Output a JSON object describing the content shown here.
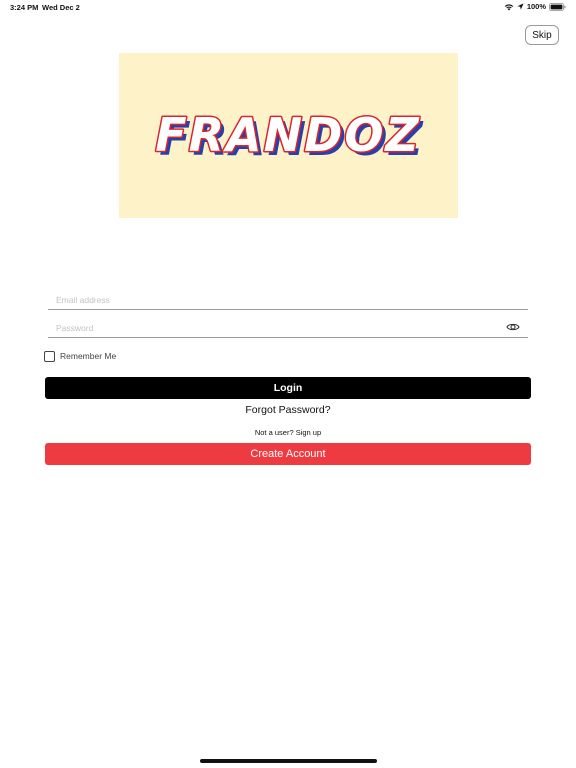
{
  "status_bar": {
    "time": "3:24 PM",
    "date": "Wed Dec 2",
    "battery": "100%"
  },
  "header": {
    "skip_label": "Skip"
  },
  "logo": {
    "text": "FRANDOZ",
    "background": "#fef3c8"
  },
  "form": {
    "email_placeholder": "Email address",
    "email_value": "",
    "password_placeholder": "Password",
    "password_value": "",
    "remember_label": "Remember Me",
    "remember_checked": false
  },
  "actions": {
    "login_label": "Login",
    "forgot_label": "Forgot Password?",
    "signup_prompt": "Not a user? Sign up",
    "create_label": "Create Account"
  },
  "colors": {
    "primary_button": "#000000",
    "create_button": "#ee3b41"
  },
  "icons": {
    "wifi": "wifi-icon",
    "location": "location-arrow-icon",
    "battery": "battery-icon",
    "password_toggle": "eye-icon"
  }
}
